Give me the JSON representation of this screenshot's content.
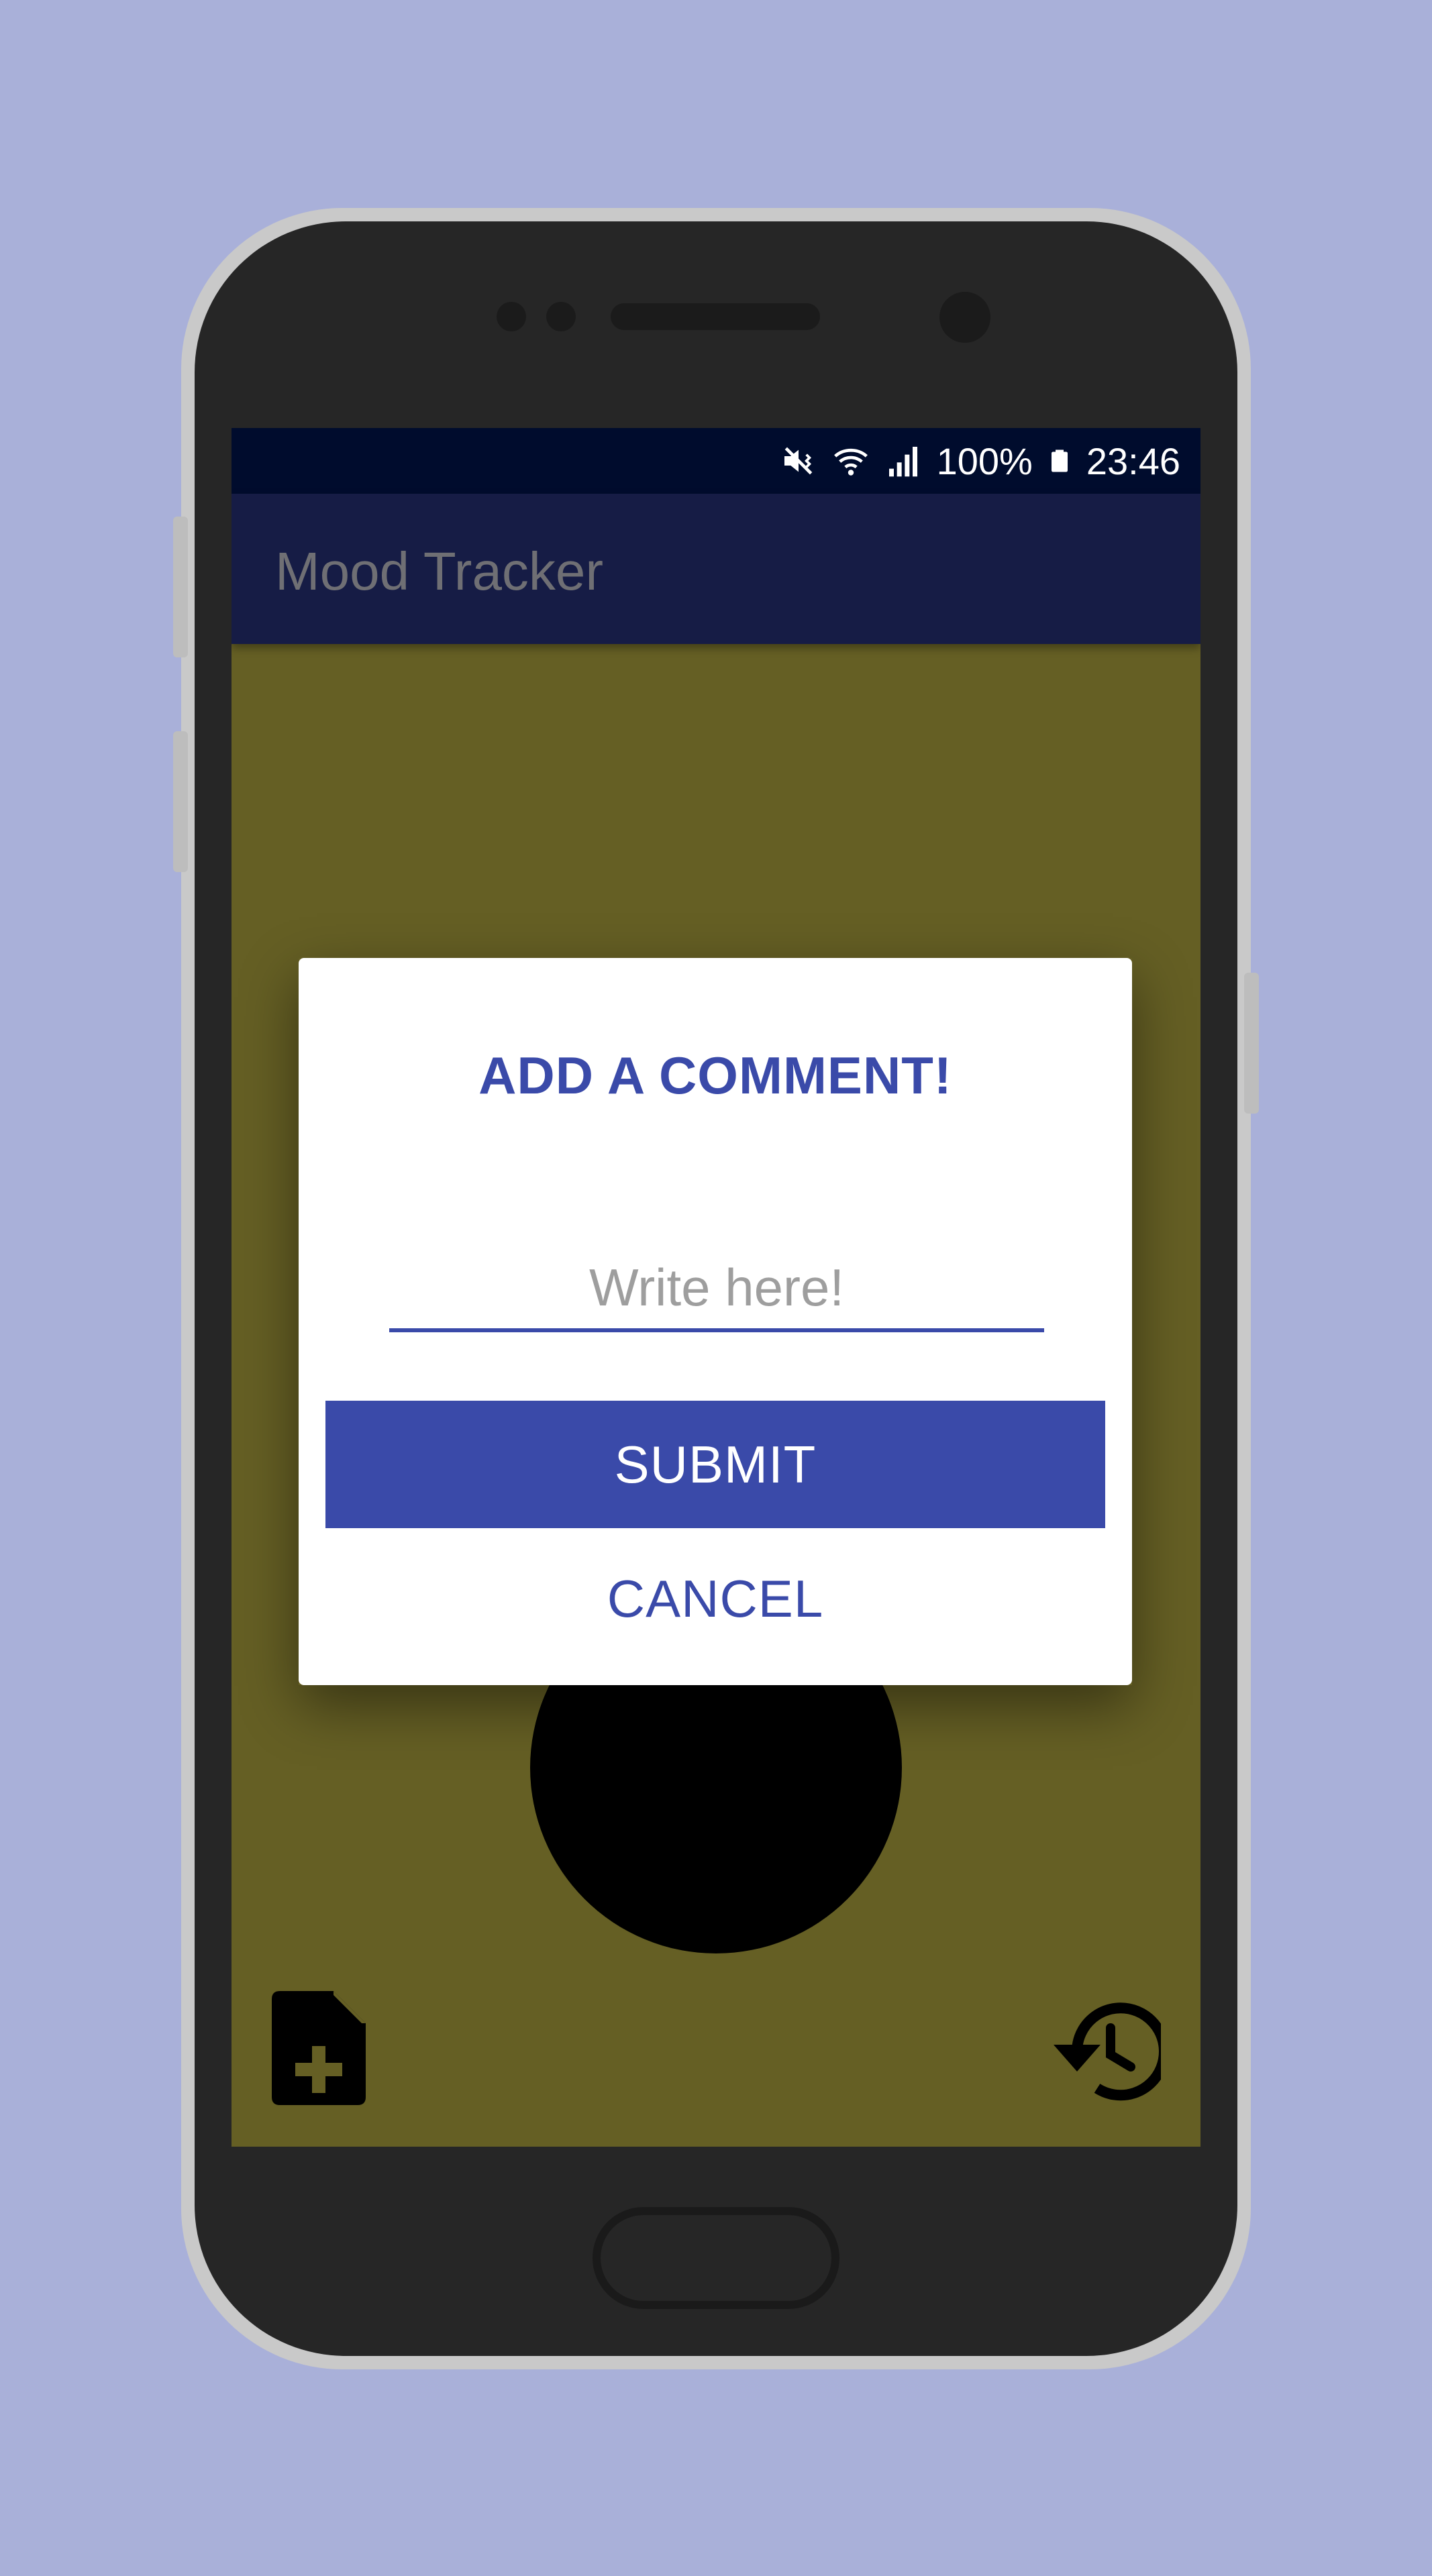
{
  "colors": {
    "background": "#a9b0d9",
    "status_bar": "#000c2d",
    "app_bar": "#161c45",
    "screen_tint": "#655f24",
    "accent": "#3a4aa9",
    "dialog": "#ffffff"
  },
  "status_bar": {
    "icons": [
      "mute-vibrate-icon",
      "wifi-icon",
      "signal-icon",
      "battery-icon"
    ],
    "battery": "100%",
    "time": "23:46"
  },
  "app_bar": {
    "title": "Mood Tracker"
  },
  "dialog": {
    "title": "ADD A COMMENT!",
    "input_placeholder": "Write here!",
    "input_value": "",
    "submit_label": "SUBMIT",
    "cancel_label": "CANCEL"
  },
  "bottom_actions": {
    "left_icon": "note-add-icon",
    "right_icon": "history-icon"
  }
}
